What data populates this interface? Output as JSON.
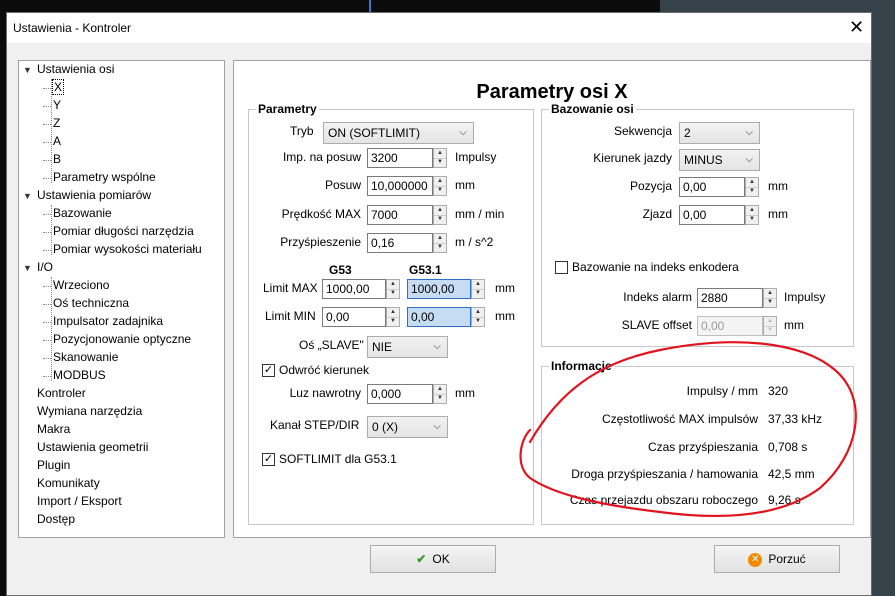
{
  "window": {
    "title": "Ustawienia - Kontroler",
    "close_glyph": "✕"
  },
  "tree": {
    "axes": "Ustawienia osi",
    "x": "X",
    "y": "Y",
    "z": "Z",
    "a": "A",
    "b": "B",
    "common": "Parametry wspólne",
    "measure": "Ustawienia pomiarów",
    "homing": "Bazowanie",
    "tool_len": "Pomiar długości narzędzia",
    "mat_height": "Pomiar wysokości materiału",
    "io": "I/O",
    "spindle": "Wrzeciono",
    "tech_axis": "Oś techniczna",
    "pulser": "Impulsator zadajnika",
    "optical": "Pozycjonowanie optyczne",
    "scan": "Skanowanie",
    "modbus": "MODBUS",
    "controller": "Kontroler",
    "toolchange": "Wymiana narzędzia",
    "macros": "Makra",
    "geometry": "Ustawienia geometrii",
    "plugin": "Plugin",
    "messages": "Komunikaty",
    "import_export": "Import / Eksport",
    "access": "Dostęp"
  },
  "panel_title": "Parametry osi X",
  "params": {
    "group": "Parametry",
    "mode_label": "Tryb",
    "mode_value": "ON (SOFTLIMIT)",
    "imp_label": "Imp. na posuw",
    "imp_value": "3200",
    "imp_unit": "Impulsy",
    "feed_label": "Posuw",
    "feed_value": "10,000000",
    "feed_unit": "mm",
    "speed_label": "Prędkość MAX",
    "speed_value": "7000",
    "speed_unit": "mm / min",
    "accel_label": "Przyśpieszenie",
    "accel_value": "0,16",
    "accel_unit": "m / s^2",
    "g53": "G53",
    "g531": "G53.1",
    "limmax_label": "Limit MAX",
    "limmax_g53": "1000,00",
    "limmax_g531": "1000,00",
    "limmax_unit": "mm",
    "limmin_label": "Limit MIN",
    "limmin_g53": "0,00",
    "limmin_g531": "0,00",
    "limmin_unit": "mm",
    "slave_label": "Oś „SLAVE\"",
    "slave_value": "NIE",
    "invert_label": "Odwróć kierunek",
    "backlash_label": "Luz nawrotny",
    "backlash_value": "0,000",
    "backlash_unit": "mm",
    "step_label": "Kanał STEP/DIR",
    "step_value": "0 (X)",
    "softlimit_label": "SOFTLIMIT dla G53.1"
  },
  "homing": {
    "group": "Bazowanie osi",
    "seq_label": "Sekwencja",
    "seq_value": "2",
    "dir_label": "Kierunek jazdy",
    "dir_value": "MINUS",
    "pos_label": "Pozycja",
    "pos_value": "0,00",
    "pos_unit": "mm",
    "exit_label": "Zjazd",
    "exit_value": "0,00",
    "exit_unit": "mm",
    "index_label": "Bazowanie na indeks enkodera",
    "alarm_label": "Indeks alarm",
    "alarm_value": "2880",
    "alarm_unit": "Impulsy",
    "slave_off_label": "SLAVE offset",
    "slave_off_value": "0,00",
    "slave_off_unit": "mm"
  },
  "info": {
    "group": "Informacje",
    "r1_label": "Impulsy / mm",
    "r1_value": "320",
    "r2_label": "Częstotliwość MAX impulsów",
    "r2_value": "37,33 kHz",
    "r3_label": "Czas przyśpieszania",
    "r3_value": "0,708 s",
    "r4_label": "Droga przyśpieszania / hamowania",
    "r4_value": "42,5 mm",
    "r5_label": "Czas przejazdu obszaru roboczego",
    "r5_value": "9,26 s"
  },
  "buttons": {
    "ok": "OK",
    "cancel": "Porzuć"
  },
  "colors": {
    "annotation": "#e0141e",
    "selection": "#c6dcf3",
    "ok_icon": "#3c9a2e",
    "cancel_icon": "#f08a00"
  }
}
